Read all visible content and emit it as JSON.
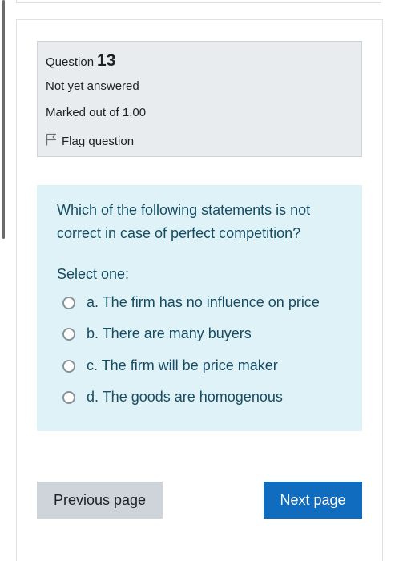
{
  "question_info": {
    "label": "Question",
    "number": "13",
    "state": "Not yet answered",
    "grade": "Marked out of 1.00",
    "flag_label": "Flag question",
    "flag_icon": "flag-outline-icon"
  },
  "question": {
    "text": "Which of the following statements is not correct in case of perfect competition?",
    "prompt": "Select one:",
    "answers": [
      {
        "label": "a. The firm has no influence on price",
        "selected": false
      },
      {
        "label": "b. There are many buyers",
        "selected": false
      },
      {
        "label": "c. The firm will be price maker",
        "selected": false
      },
      {
        "label": "d. The goods are homogenous",
        "selected": false
      }
    ]
  },
  "navigation": {
    "previous_label": "Previous page",
    "next_label": "Next page"
  },
  "colors": {
    "info_background": "#e9ecef",
    "question_background": "#def2f8",
    "question_text": "#174c63",
    "next_button": "#0f6cbf",
    "previous_button": "#ced4da"
  }
}
